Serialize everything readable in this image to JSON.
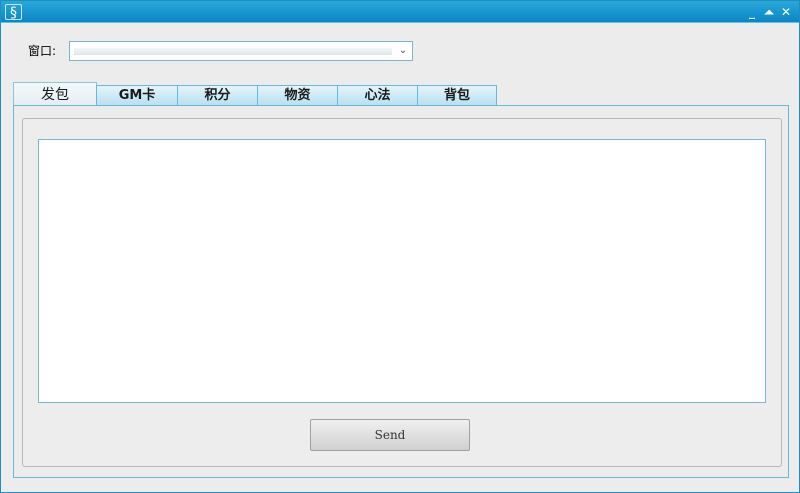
{
  "titlebar": {
    "app_icon_glyph": "§",
    "min_glyph": "_",
    "max_glyph": "⏶",
    "close_glyph": "✕"
  },
  "window_picker": {
    "label": "窗口:",
    "value": "",
    "arrow_glyph": "⌄"
  },
  "tabs": [
    {
      "label": "发包",
      "active": true
    },
    {
      "label": "GM卡",
      "active": false
    },
    {
      "label": "积分",
      "active": false
    },
    {
      "label": "物资",
      "active": false
    },
    {
      "label": "心法",
      "active": false
    },
    {
      "label": "背包",
      "active": false
    }
  ],
  "send_panel": {
    "textarea_value": "",
    "send_label": "Send"
  },
  "colors": {
    "titlebar": "#0a86c6",
    "tab_fill": "#b4e0f2",
    "border_accent": "#6bb8d6"
  }
}
